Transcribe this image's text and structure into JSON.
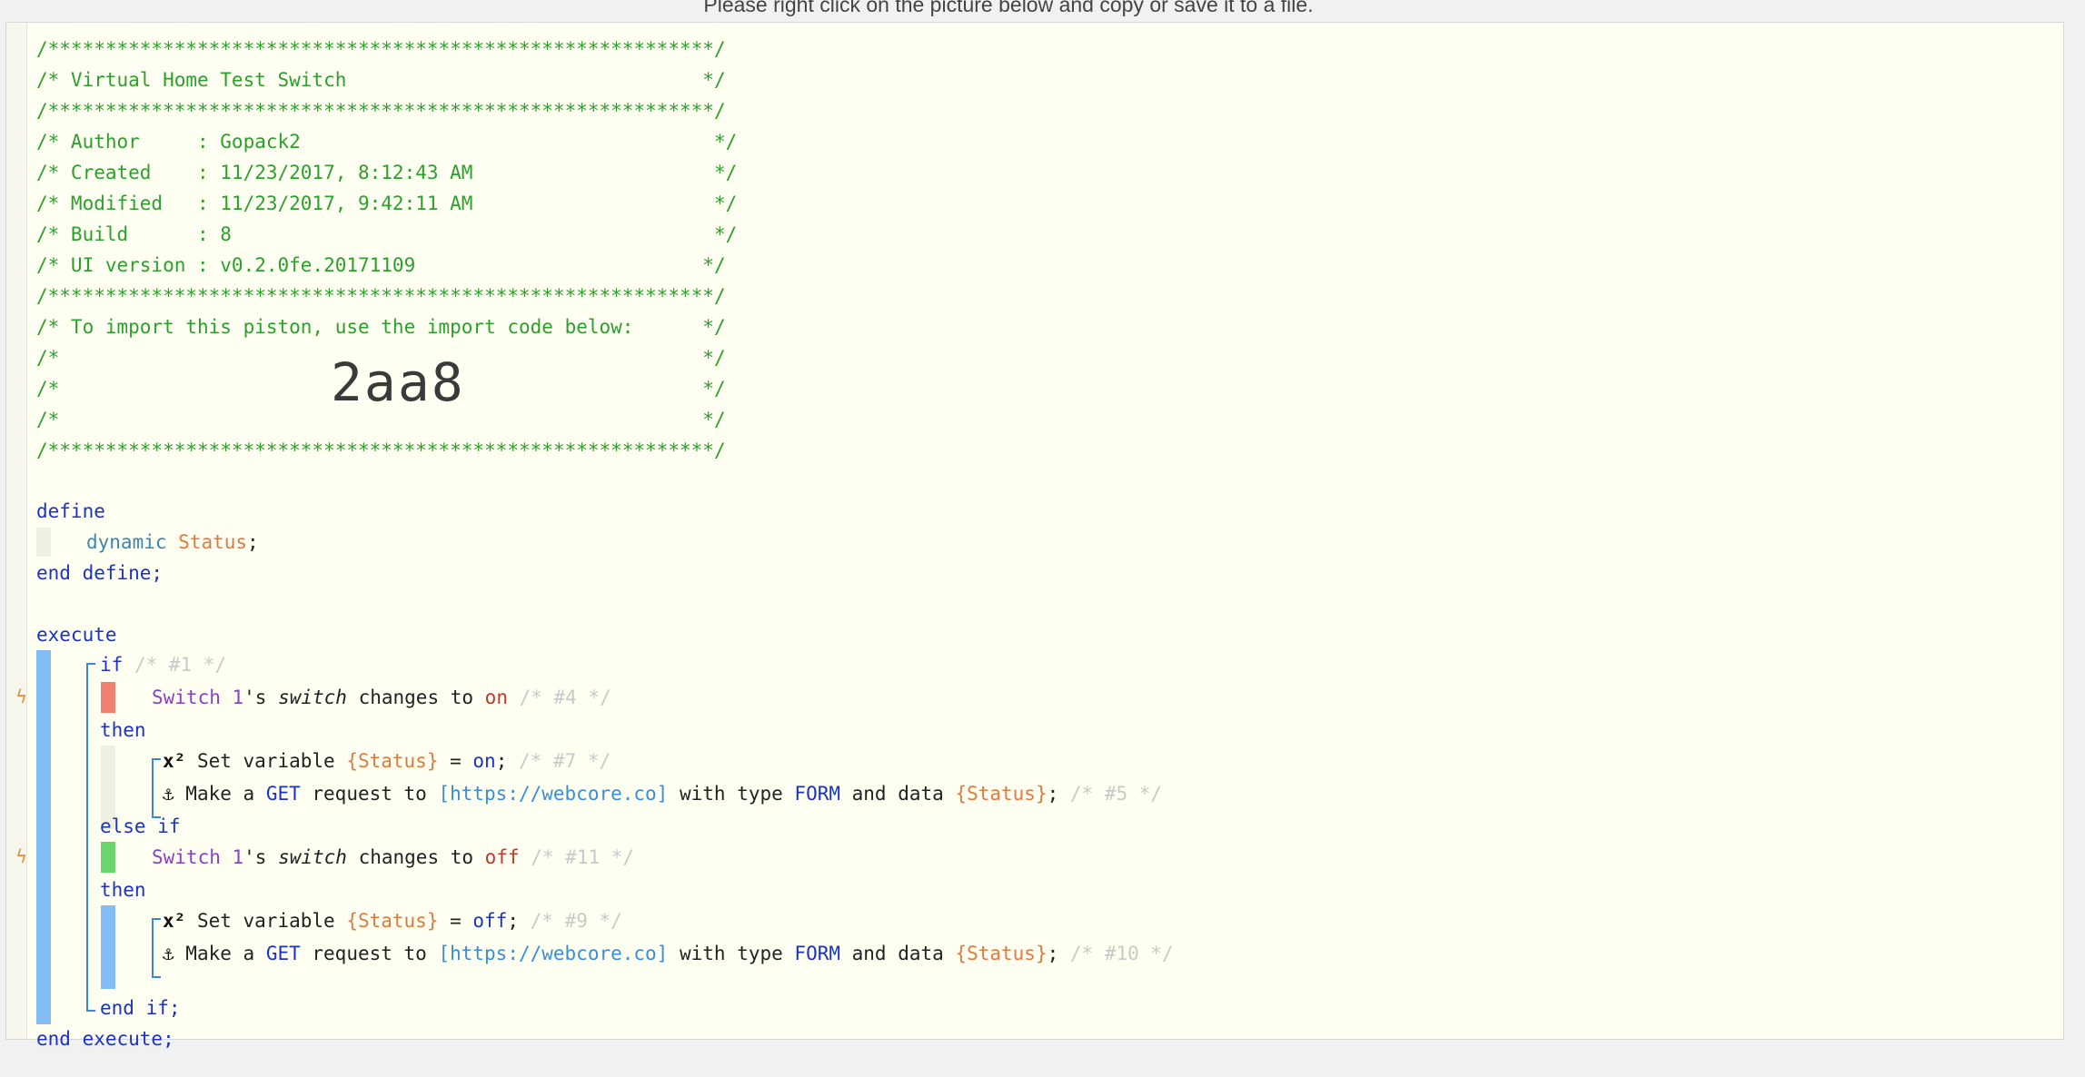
{
  "notice": "Please right click on the picture below and copy or save it to a file.",
  "header": {
    "border": "/**********************************************************/",
    "title_line": "/* Virtual Home Test Switch                               */",
    "author_line": "/* Author     : Gopack2                                    */",
    "created_line": "/* Created    : 11/23/2017, 8:12:43 AM                     */",
    "modified_line": "/* Modified   : 11/23/2017, 9:42:11 AM                     */",
    "build_line": "/* Build      : 8                                          */",
    "ui_line": "/* UI version : v0.2.0fe.20171109                         */",
    "import_line": "/* To import this piston, use the import code below:      */",
    "empty_line": "/*                                                        */",
    "import_code": "2aa8"
  },
  "define": {
    "open": "define",
    "type": "dynamic",
    "var": "Status",
    "semi": ";",
    "close": "end define;"
  },
  "execute": {
    "open": "execute",
    "if": "if",
    "if_comment": "/* #1 */",
    "cond1": {
      "device": "Switch 1",
      "poss": "'s ",
      "attr": "switch",
      "op": " changes to ",
      "value": "on",
      "comment": " /* #4 */"
    },
    "then": "then",
    "set1": {
      "icon": "x²",
      "text": " Set variable ",
      "var": "{Status}",
      "eq": " = ",
      "val": "on",
      "semi": ";",
      "comment": " /* #7 */"
    },
    "req1": {
      "icon": "⚓",
      "text": " Make a ",
      "method": "GET",
      "mid": " request to ",
      "url": "[https://webcore.co]",
      "mid2": " with type ",
      "type": "FORM",
      "mid3": " and data ",
      "var": "{Status}",
      "semi": ";",
      "comment": " /* #5 */"
    },
    "else_if": "else if",
    "cond2": {
      "device": "Switch 1",
      "poss": "'s ",
      "attr": "switch",
      "op": " changes to ",
      "value": "off",
      "comment": " /* #11 */"
    },
    "then2": "then",
    "set2": {
      "icon": "x²",
      "text": " Set variable ",
      "var": "{Status}",
      "eq": " = ",
      "val": "off",
      "semi": ";",
      "comment": " /* #9 */"
    },
    "req2": {
      "icon": "⚓",
      "text": " Make a ",
      "method": "GET",
      "mid": " request to ",
      "url": "[https://webcore.co]",
      "mid2": " with type ",
      "type": "FORM",
      "mid3": " and data ",
      "var": "{Status}",
      "semi": ";",
      "comment": " /* #10 */"
    },
    "end_if": "end if;",
    "close": "end execute;"
  },
  "colors": {
    "comment": "#2ca02c",
    "keyword": "#1a33c6",
    "variable": "#e07a3f",
    "device": "#8a3fc7",
    "trigger_on": "#f08070",
    "trigger_off": "#6cd46c",
    "block_bar": "#82bdf5"
  }
}
